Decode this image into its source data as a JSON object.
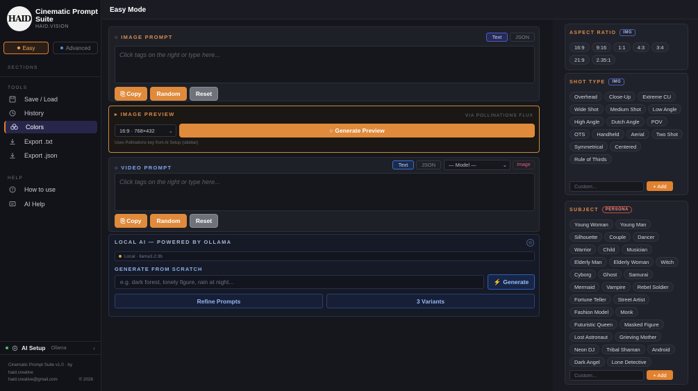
{
  "sidebar": {
    "logo_text": "HAID",
    "title": "Cinematic Prompt Suite",
    "subtitle": "HAID.VISION",
    "modes": [
      {
        "label": "Easy",
        "active": true
      },
      {
        "label": "Advanced",
        "active": false
      }
    ],
    "sections_label": "SECTIONS",
    "tools_label": "TOOLS",
    "tools": [
      {
        "label": "Save / Load",
        "icon": "save-icon"
      },
      {
        "label": "History",
        "icon": "clock-icon"
      },
      {
        "label": "Colors",
        "icon": "palette-icon",
        "active": true
      },
      {
        "label": "Export .txt",
        "icon": "download-icon"
      },
      {
        "label": "Export .json",
        "icon": "download-icon"
      }
    ],
    "help_label": "HELP",
    "help": [
      {
        "label": "How to use",
        "icon": "help-circle-icon"
      },
      {
        "label": "AI Help",
        "icon": "chat-icon"
      }
    ],
    "ai_setup": {
      "label": "AI Setup",
      "value": "Ollama",
      "chevron": "‹"
    },
    "footer": {
      "line1": "Cinematic Prompt Suite v1.0 · by",
      "line2": "haid.creative",
      "email": "haid.creative@gmail.com",
      "year": "© 2026"
    }
  },
  "topbar": {
    "title": "Easy Mode"
  },
  "image_prompt": {
    "title": "IMAGE PROMPT",
    "formats": [
      "Text",
      "JSON"
    ],
    "placeholder": "Click tags on the right or type here...",
    "buttons": {
      "copy": "Copy",
      "random": "Random",
      "reset": "Reset"
    }
  },
  "image_preview": {
    "title": "IMAGE PREVIEW",
    "via": "VIA POLLINATIONS FLUX",
    "size_value": "16:9 · 768×432",
    "generate": "Generate Preview",
    "note": "Uses Pollinations key from AI Setup (sidebar)"
  },
  "video_prompt": {
    "title": "VIDEO PROMPT",
    "formats": [
      "Text",
      "JSON"
    ],
    "model_value": "— Model —",
    "image_tag": "Image",
    "placeholder": "Click tags on the right or type here...",
    "buttons": {
      "copy": "Copy",
      "random": "Random",
      "reset": "Reset"
    }
  },
  "local_ai": {
    "title": "LOCAL AI — POWERED BY OLLAMA",
    "status": "Local · llama3.2:3b",
    "scratch_label": "GENERATE FROM SCRATCH",
    "placeholder": "e.g. dark forest, lonely figure, rain at night...",
    "generate": "Generate",
    "refine": "Refine Prompts",
    "variants": "3 Variants"
  },
  "aspect_ratio": {
    "title": "ASPECT RATIO",
    "badge": "IMG",
    "tags": [
      "16:9",
      "9:16",
      "1:1",
      "4:3",
      "3:4",
      "21:9",
      "2.35:1"
    ]
  },
  "shot_type": {
    "title": "SHOT TYPE",
    "badge": "IMG",
    "tags": [
      "Overhead",
      "Close-Up",
      "Extreme CU",
      "Wide Shot",
      "Medium Shot",
      "Low Angle",
      "High Angle",
      "Dutch Angle",
      "POV",
      "OTS",
      "Handheld",
      "Aerial",
      "Two Shot",
      "Symmetrical",
      "Centered",
      "Rule of Thirds"
    ],
    "custom_placeholder": "Custom...",
    "add": "+ Add"
  },
  "subject": {
    "title": "SUBJECT",
    "badge": "PERSONA",
    "tags": [
      "Young Woman",
      "Young Man",
      "Silhouette",
      "Couple",
      "Dancer",
      "Warrior",
      "Child",
      "Musician",
      "Elderly Man",
      "Elderly Woman",
      "Witch",
      "Cyborg",
      "Ghost",
      "Samurai",
      "Mermaid",
      "Vampire",
      "Rebel Soldier",
      "Fortune Teller",
      "Street Artist",
      "Fashion Model",
      "Monk",
      "Futuristic Queen",
      "Masked Figure",
      "Lost Astronaut",
      "Grieving Mother",
      "Neon DJ",
      "Tribal Shaman",
      "Android",
      "Dark Angel",
      "Lone Detective"
    ],
    "custom_placeholder": "Custom...",
    "add": "+ Add"
  },
  "colors": {
    "accent": "#e08a3c",
    "active_nav": "#27264a",
    "blue": "#3a6fd8"
  }
}
